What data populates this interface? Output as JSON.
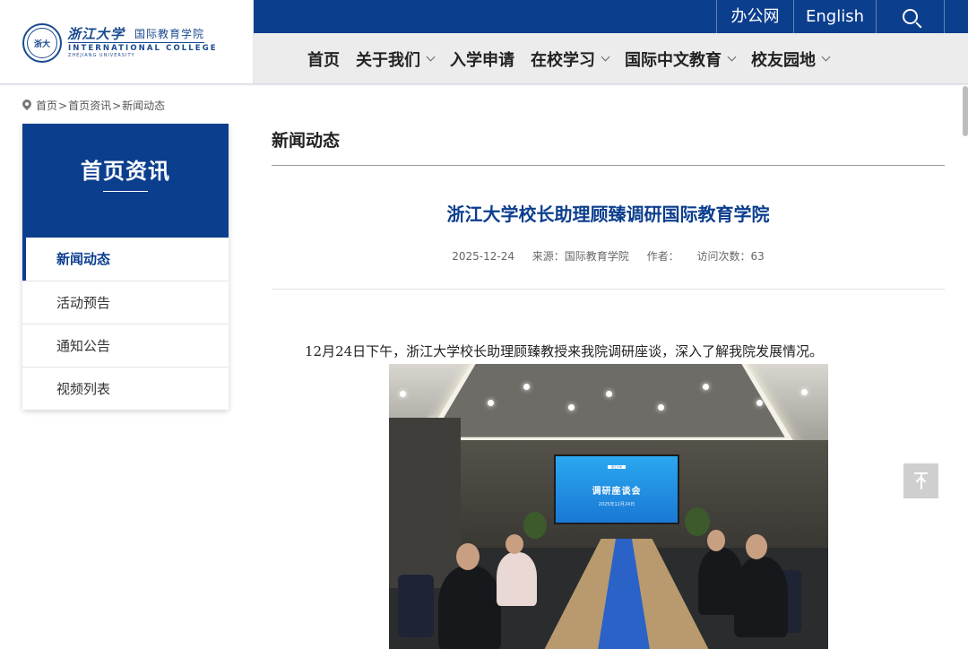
{
  "header": {
    "logo_seal_text": "浙大",
    "logo_name_cn": "浙江大学",
    "logo_college_cn": "国际教育学院",
    "logo_college_en": "INTERNATIONAL COLLEGE",
    "logo_university_en": "ZHEJIANG UNIVERSITY",
    "top_links": {
      "office": "办公网",
      "english": "English"
    },
    "nav": [
      {
        "label": "首页",
        "has_dropdown": false
      },
      {
        "label": "关于我们",
        "has_dropdown": true
      },
      {
        "label": "入学申请",
        "has_dropdown": false
      },
      {
        "label": "在校学习",
        "has_dropdown": true
      },
      {
        "label": "国际中文教育",
        "has_dropdown": true
      },
      {
        "label": "校友园地",
        "has_dropdown": true
      }
    ]
  },
  "breadcrumb": {
    "home": "首页",
    "sep1": ">",
    "section": "首页资讯",
    "sep2": ">",
    "current": "新闻动态"
  },
  "sidebar": {
    "title": "首页资讯",
    "items": [
      {
        "label": "新闻动态",
        "active": true
      },
      {
        "label": "活动预告",
        "active": false
      },
      {
        "label": "通知公告",
        "active": false
      },
      {
        "label": "视频列表",
        "active": false
      }
    ]
  },
  "main": {
    "section_title": "新闻动态",
    "article": {
      "title": "浙江大学校长助理顾臻调研国际教育学院",
      "date": "2025-12-24",
      "source": "来源：国际教育学院",
      "author": "作者：",
      "views": "访问次数：63",
      "paragraph": "12月24日下午，浙江大学校长助理顾臻教授来我院调研座谈，深入了解我院发展情况。",
      "photo": {
        "screen_title": "调研座谈会",
        "screen_logo": "浙江大学",
        "screen_date": "2025年12月24日"
      }
    }
  },
  "colors": {
    "brand_blue": "#0c3e8e",
    "nav_bg": "#ececec"
  },
  "icons": {
    "search": "search-icon",
    "location": "location-pin-icon",
    "back_to_top": "back-to-top-icon",
    "dropdown": "chevron-down-icon"
  }
}
